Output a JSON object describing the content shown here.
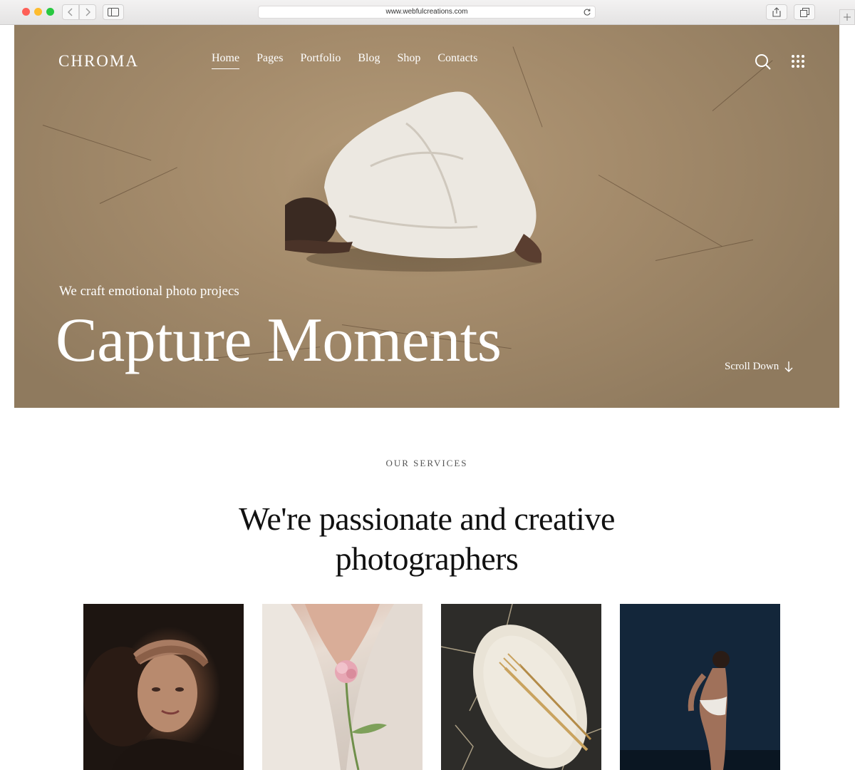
{
  "browser": {
    "url": "www.webfulcreations.com"
  },
  "hero": {
    "logo": "CHROMA",
    "nav": [
      {
        "label": "Home",
        "active": true
      },
      {
        "label": "Pages",
        "active": false
      },
      {
        "label": "Portfolio",
        "active": false
      },
      {
        "label": "Blog",
        "active": false
      },
      {
        "label": "Shop",
        "active": false
      },
      {
        "label": "Contacts",
        "active": false
      }
    ],
    "tagline": "We craft emotional photo projecs",
    "title": "Capture Moments",
    "scroll_label": "Scroll Down",
    "icons": {
      "search": "search-icon",
      "menu": "grid-menu-icon",
      "scroll": "arrow-down-icon"
    }
  },
  "services": {
    "eyebrow": "OUR SERVICES",
    "heading_line1": "We're passionate and creative",
    "heading_line2": "photographers"
  },
  "colors": {
    "hero_sand": "#a48b6b",
    "text_dark": "#111111",
    "white": "#ffffff"
  }
}
